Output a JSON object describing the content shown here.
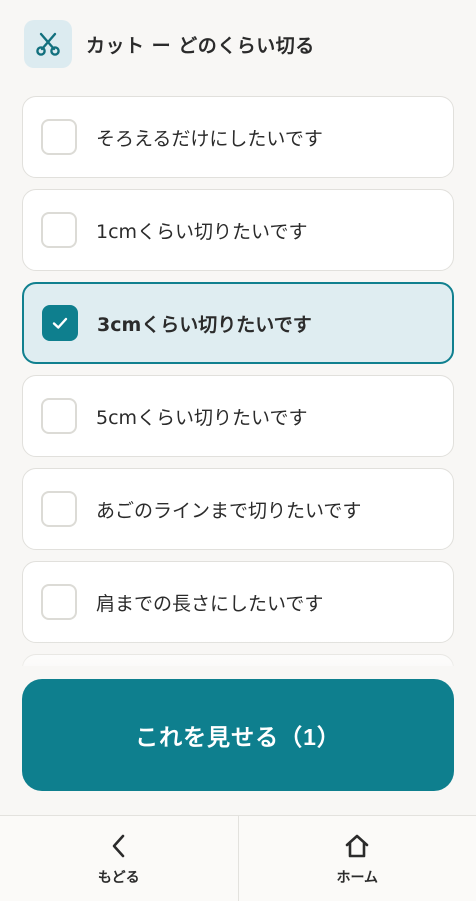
{
  "header": {
    "icon": "scissors-icon",
    "title": "カット ー どのくらい切る"
  },
  "options": [
    {
      "label": "そろえるだけにしたいです",
      "checked": false
    },
    {
      "label": "1cmくらい切りたいです",
      "checked": false
    },
    {
      "label": "3cmくらい切りたいです",
      "checked": true
    },
    {
      "label": "5cmくらい切りたいです",
      "checked": false
    },
    {
      "label": "あごのラインまで切りたいです",
      "checked": false
    },
    {
      "label": "肩までの長さにしたいです",
      "checked": false
    }
  ],
  "primary_button": {
    "label": "これを見せる（1）"
  },
  "bottom_nav": {
    "back": {
      "label": "もどる",
      "icon": "chevron-left-icon"
    },
    "home": {
      "label": "ホーム",
      "icon": "home-icon"
    }
  },
  "colors": {
    "accent": "#0e7f8e",
    "selected_bg": "#dfedf1",
    "background": "#f8f7f5"
  }
}
